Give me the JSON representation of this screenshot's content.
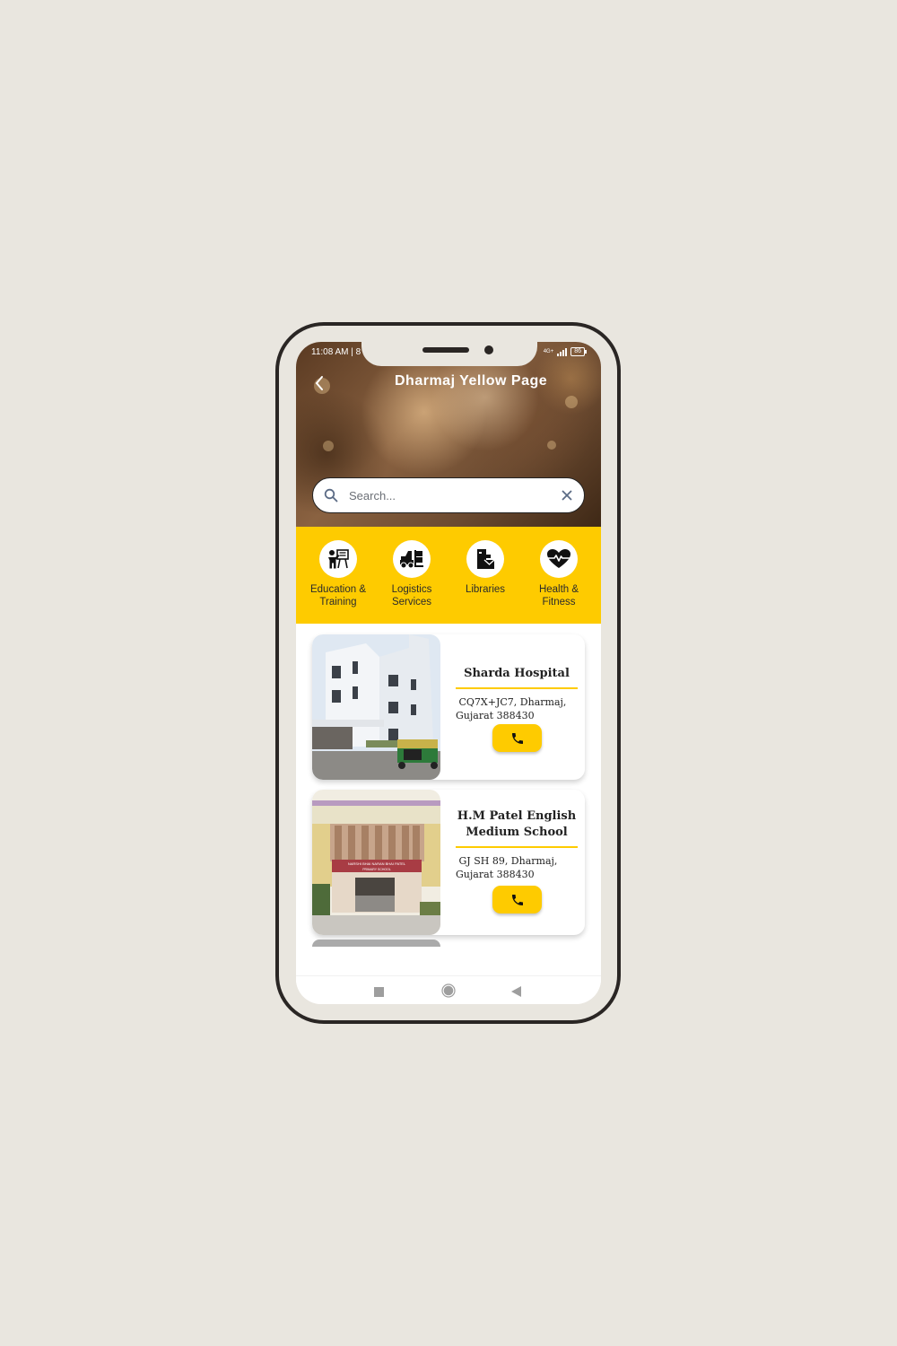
{
  "status_bar": {
    "time": "11:08 AM | 8",
    "network": "4G+",
    "battery": "86"
  },
  "header": {
    "title": "Dharmaj Yellow Page",
    "back_icon": "chevron-left-icon"
  },
  "search": {
    "placeholder": "Search...",
    "value": "",
    "search_icon": "search-icon",
    "clear_icon": "close-icon"
  },
  "categories": [
    {
      "label_line1": "Education &",
      "label_line2": "Training",
      "icon": "teacher-board-icon"
    },
    {
      "label_line1": "Logistics",
      "label_line2": "Services",
      "icon": "forklift-icon"
    },
    {
      "label_line1": "Libraries",
      "label_line2": "",
      "icon": "library-icon"
    },
    {
      "label_line1": "Health &",
      "label_line2": "Fitness",
      "icon": "heart-pulse-icon"
    }
  ],
  "listings": [
    {
      "name": "Sharda Hospital",
      "address_line1": "CQ7X+JC7, Dharmaj,",
      "address_line2": "Gujarat 388430",
      "call_icon": "phone-icon"
    },
    {
      "name_line1": "H.M Patel English",
      "name_line2": "Medium School",
      "address_line1": "GJ SH 89, Dharmaj,",
      "address_line2": "Gujarat 388430",
      "sign_text_line1": "NARSHI BHAI NARAN BHAI PATEL",
      "sign_text_line2": "PRIMARY SCHOOL",
      "call_icon": "phone-icon"
    }
  ],
  "nav": {
    "recents_icon": "square-icon",
    "home_icon": "circle-icon",
    "back_icon": "triangle-back-icon"
  },
  "colors": {
    "accent": "#fecb00",
    "frame": "#2a2624",
    "background": "#e9e6df"
  }
}
